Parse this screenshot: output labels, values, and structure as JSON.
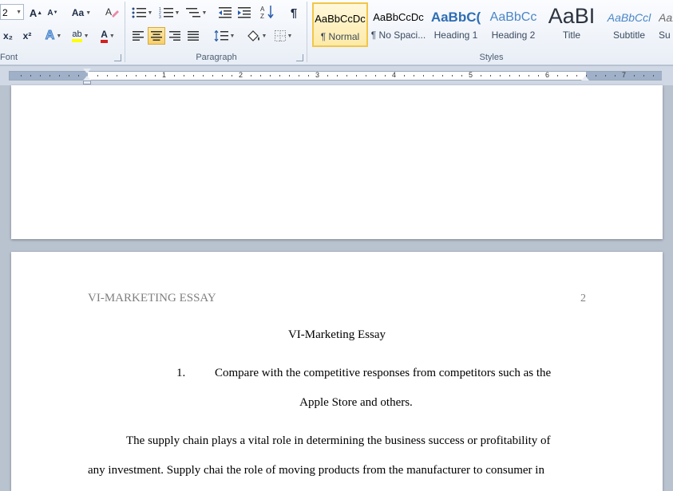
{
  "ribbon": {
    "font": {
      "group_label": "Font",
      "font_size": "2",
      "grow_font": "A",
      "shrink_font": "A",
      "change_case": "Aa",
      "subscript": "x₂",
      "superscript": "x²",
      "text_effects": "A",
      "highlight": "ab",
      "font_color": "A"
    },
    "paragraph": {
      "group_label": "Paragraph",
      "show_marks": "¶"
    },
    "styles": {
      "group_label": "Styles",
      "items": [
        {
          "sample": "AaBbCcDc",
          "name": "¶ Normal"
        },
        {
          "sample": "AaBbCcDc",
          "name": "¶ No Spaci..."
        },
        {
          "sample": "AaBbC(",
          "name": "Heading 1"
        },
        {
          "sample": "AaBbCc",
          "name": "Heading 2"
        },
        {
          "sample": "AaBI",
          "name": "Title"
        },
        {
          "sample": "AaBbCcl",
          "name": "Subtitle"
        },
        {
          "sample": "AaBbC",
          "name": "Su"
        }
      ]
    }
  },
  "ruler": {
    "numbers": [
      "1",
      "2",
      "3",
      "4",
      "5",
      "6",
      "7"
    ]
  },
  "document": {
    "header": "VI-MARKETING ESSAY",
    "page_number": "2",
    "title": "VI-Marketing Essay",
    "list_item": {
      "number": "1.",
      "line1": "Compare with the competitive responses from competitors such as the",
      "line2": "Apple Store and others."
    },
    "paragraph_lines": [
      "The supply chain plays a vital role in determining the business success or profitability of",
      "any investment. Supply chai the role of moving products from the manufacturer to consumer in"
    ]
  },
  "colors": {
    "selected_style": "#f2c649",
    "header_gray": "#7f7f7f",
    "heading_blue": "#2e6db4"
  }
}
